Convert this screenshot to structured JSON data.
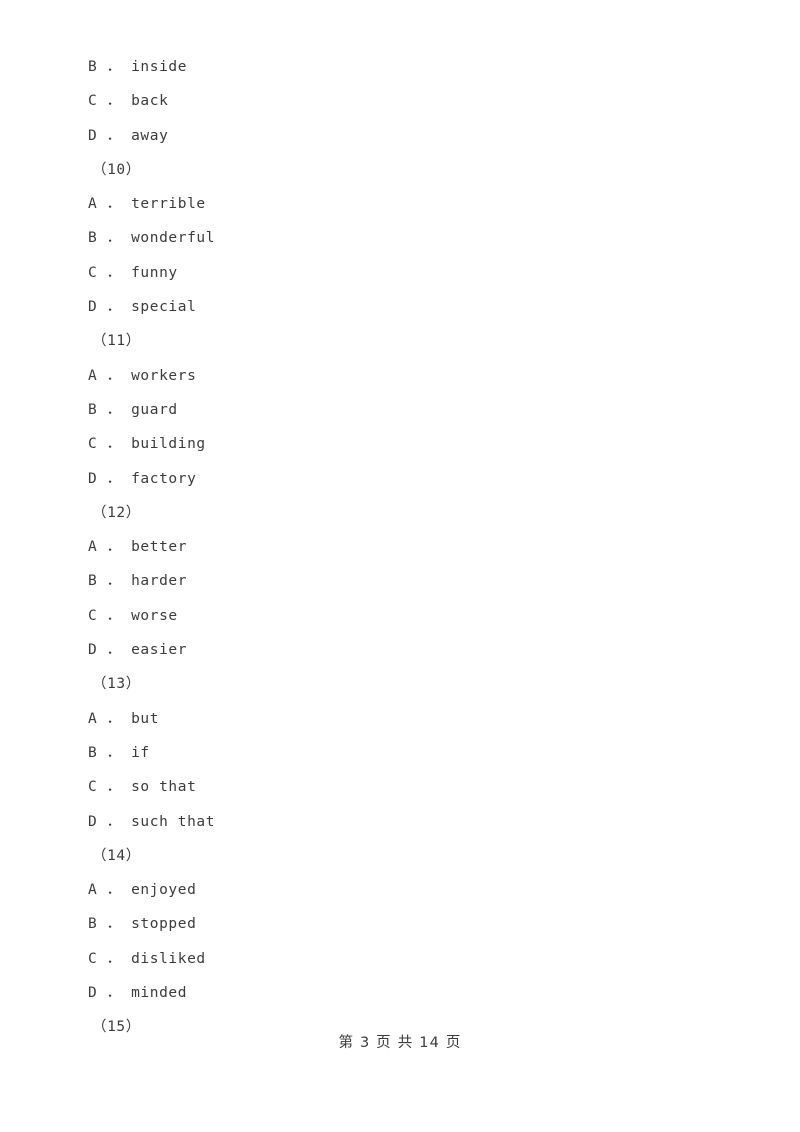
{
  "document": {
    "type": "exam-paper",
    "page_background": "#ffffff",
    "text_color": "#3c3c3c"
  },
  "body_lines": [
    {
      "kind": "option",
      "text": "B ． inside"
    },
    {
      "kind": "option",
      "text": "C ． back"
    },
    {
      "kind": "option",
      "text": "D ． away"
    },
    {
      "kind": "qnum",
      "text": "（10）"
    },
    {
      "kind": "option",
      "text": "A ． terrible"
    },
    {
      "kind": "option",
      "text": "B ． wonderful"
    },
    {
      "kind": "option",
      "text": "C ． funny"
    },
    {
      "kind": "option",
      "text": "D ． special"
    },
    {
      "kind": "qnum",
      "text": "（11）"
    },
    {
      "kind": "option",
      "text": "A ． workers"
    },
    {
      "kind": "option",
      "text": "B ． guard"
    },
    {
      "kind": "option",
      "text": "C ． building"
    },
    {
      "kind": "option",
      "text": "D ． factory"
    },
    {
      "kind": "qnum",
      "text": "（12）"
    },
    {
      "kind": "option",
      "text": "A ． better"
    },
    {
      "kind": "option",
      "text": "B ． harder"
    },
    {
      "kind": "option",
      "text": "C ． worse"
    },
    {
      "kind": "option",
      "text": "D ． easier"
    },
    {
      "kind": "qnum",
      "text": "（13）"
    },
    {
      "kind": "option",
      "text": "A ． but"
    },
    {
      "kind": "option",
      "text": "B ． if"
    },
    {
      "kind": "option",
      "text": "C ． so that"
    },
    {
      "kind": "option",
      "text": "D ． such that"
    },
    {
      "kind": "qnum",
      "text": "（14）"
    },
    {
      "kind": "option",
      "text": "A ． enjoyed"
    },
    {
      "kind": "option",
      "text": "B ． stopped"
    },
    {
      "kind": "option",
      "text": "C ． disliked"
    },
    {
      "kind": "option",
      "text": "D ． minded"
    },
    {
      "kind": "qnum",
      "text": "（15）"
    }
  ],
  "footer": {
    "text": "第 3 页 共 14 页",
    "current_page": "3",
    "total_pages": "14"
  }
}
